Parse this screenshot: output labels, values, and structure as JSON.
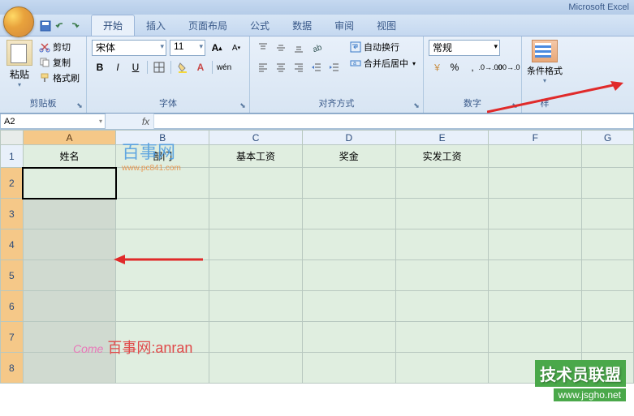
{
  "title_suffix": "Microsoft Excel",
  "tabs": {
    "start": "开始",
    "insert": "插入",
    "layout": "页面布局",
    "formula": "公式",
    "data": "数据",
    "review": "审阅",
    "view": "视图"
  },
  "clipboard": {
    "paste": "粘贴",
    "cut": "剪切",
    "copy": "复制",
    "format_painter": "格式刷",
    "group_label": "剪贴板"
  },
  "font": {
    "name": "宋体",
    "size": "11",
    "group_label": "字体"
  },
  "alignment": {
    "wrap": "自动换行",
    "merge": "合并后居中",
    "group_label": "对齐方式"
  },
  "number": {
    "format": "常规",
    "group_label": "数字"
  },
  "styles": {
    "cond_format": "条件格式",
    "group_label": "样"
  },
  "namebox": "A2",
  "columns": [
    "A",
    "B",
    "C",
    "D",
    "E",
    "F",
    "G"
  ],
  "rows": [
    "1",
    "2",
    "3",
    "4",
    "5",
    "6",
    "7",
    "8"
  ],
  "headers": {
    "A": "姓名",
    "B": "部门",
    "C": "基本工资",
    "D": "奖金",
    "E": "实发工资"
  },
  "watermarks": {
    "w1": "百事网",
    "w1_sub": "www.pc841.com",
    "w2_pink": "Come",
    "w2_text": "百事网:anran",
    "w3_t1": "技术员联盟",
    "w3_t2": "www.jsgho.net"
  }
}
